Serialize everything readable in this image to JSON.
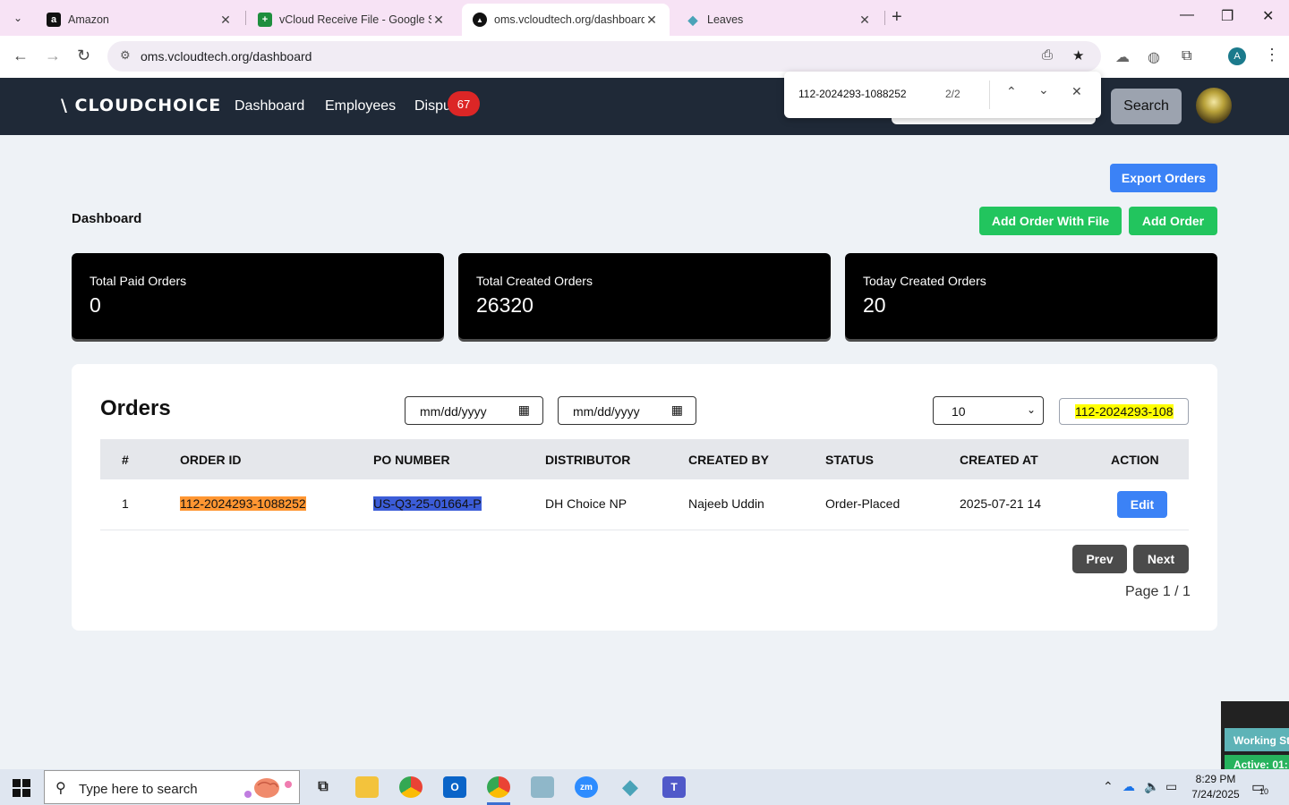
{
  "browser": {
    "tabs": [
      {
        "title": "Amazon",
        "fav": "a",
        "fav_color": "#111111"
      },
      {
        "title": "vCloud Receive File - Google Sh",
        "fav": "+",
        "fav_color": "#1e8e3e"
      },
      {
        "title": "oms.vcloudtech.org/dashboard",
        "fav": "▲",
        "fav_color": "#111111"
      },
      {
        "title": "Leaves",
        "fav": "◆",
        "fav_color": "#4aa3b8"
      }
    ],
    "url": "oms.vcloudtech.org/dashboard",
    "profile_initial": "A"
  },
  "find_bar": {
    "query": "112-2024293-1088252",
    "count": "2/2"
  },
  "app_nav": {
    "logo": "\\ CLOUDCHOICE",
    "links": [
      "Dashboard",
      "Employees",
      "Dispu"
    ],
    "badge_count": "67",
    "search_button": "Search"
  },
  "actions": {
    "export_orders": "Export Orders",
    "add_order_with_file": "Add Order With File",
    "add_order": "Add Order"
  },
  "page_title": "Dashboard",
  "stats": [
    {
      "label": "Total Paid Orders",
      "value": "0"
    },
    {
      "label": "Total Created Orders",
      "value": "26320"
    },
    {
      "label": "Today Created Orders",
      "value": "20"
    }
  ],
  "orders": {
    "title": "Orders",
    "date_from_placeholder": "mm/dd/yyyy",
    "date_to_placeholder": "mm/dd/yyyy",
    "page_size": "10",
    "search_value": "112-2024293-108",
    "columns": [
      "#",
      "ORDER ID",
      "PO NUMBER",
      "DISTRIBUTOR",
      "CREATED BY",
      "STATUS",
      "CREATED AT",
      "ACTION"
    ],
    "rows": [
      {
        "index": "1",
        "order_id": "112-2024293-1088252",
        "po_number": "US-Q3-25-01664-P",
        "distributor": "DH Choice NP",
        "created_by": "Najeeb Uddin",
        "status": "Order-Placed",
        "created_at": "2025-07-21 14",
        "action": "Edit"
      }
    ],
    "prev": "Prev",
    "next": "Next",
    "page_info": "Page 1 / 1"
  },
  "widget": {
    "working": "Working St",
    "active": "Active: 01:"
  },
  "taskbar": {
    "search_placeholder": "Type here to search",
    "time": "8:29 PM",
    "date": "7/24/2025",
    "notifications": "10"
  },
  "colors": {
    "nav_bg": "#1f2937",
    "primary": "#3b82f6",
    "success": "#22c55e",
    "badge": "#dc2626"
  }
}
